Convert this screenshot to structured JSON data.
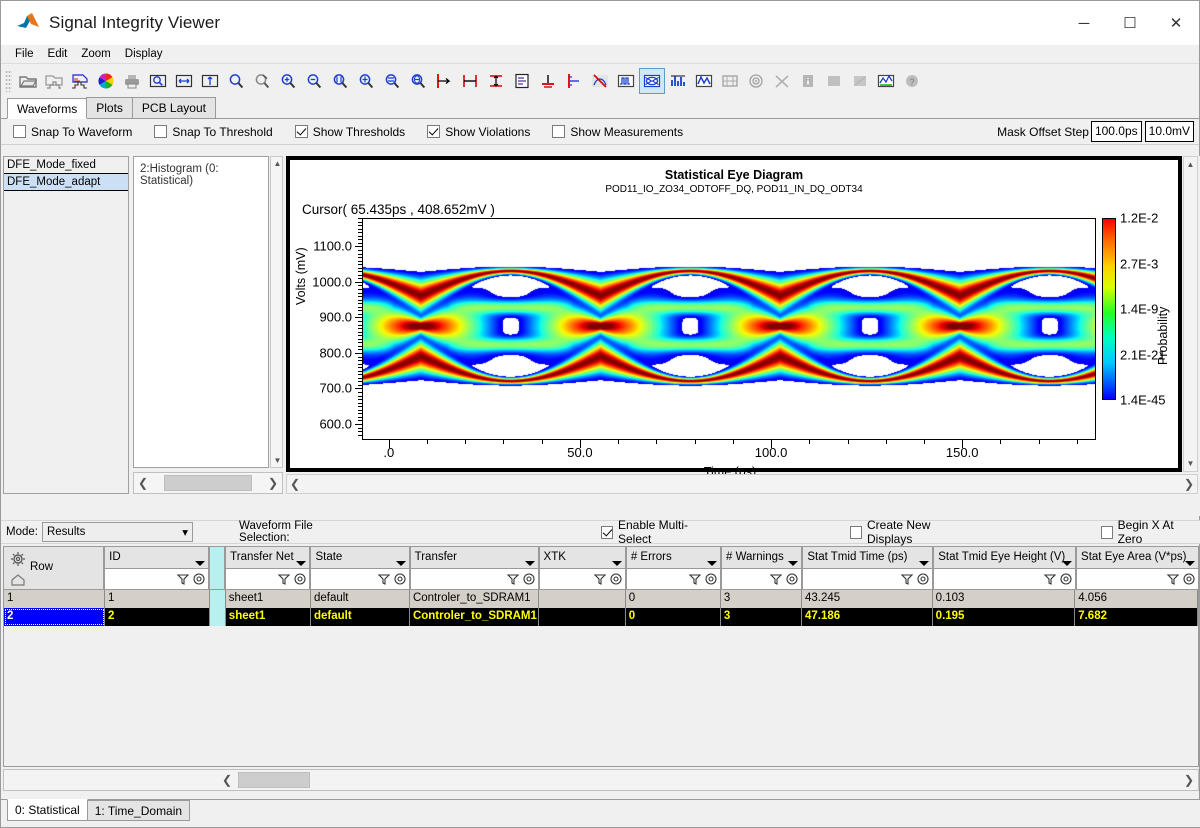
{
  "window": {
    "title": "Signal Integrity Viewer",
    "icon": "matlab-logo-icon",
    "minimize": "─",
    "maximize": "☐",
    "close": "✕"
  },
  "menu": {
    "items": [
      "File",
      "Edit",
      "Zoom",
      "Display"
    ]
  },
  "toolbar": {
    "icons": [
      "open-folder-icon",
      "open-waveform-icon",
      "save-waveform-icon",
      "color-wheel-icon",
      "print-icon",
      "zoom-region-icon",
      "pan-icon",
      "image-export-icon",
      "magnifier-icon",
      "magnifier-reset-icon",
      "zoom-in-icon",
      "zoom-out-icon",
      "zoom-x-in-icon",
      "zoom-x-out-icon",
      "zoom-y-in-icon",
      "zoom-y-out-icon",
      "cursor-left-icon",
      "measure-width-icon",
      "measure-height-icon",
      "notes-icon",
      "ground-ref-icon",
      "marker-icon",
      "no-crosstalk-icon",
      "waveform-view-icon",
      "eye-diagram-icon",
      "histogram-icon",
      "analog-wave-icon",
      "mask-icon",
      "bathtub-icon",
      "crossing-icon",
      "info-icon",
      "block1-icon",
      "block2-icon",
      "overlay-icon",
      "help-icon"
    ],
    "active_icon_index": 24
  },
  "tabs": {
    "items": [
      "Waveforms",
      "Plots",
      "PCB Layout"
    ],
    "selected": "Waveforms"
  },
  "options": {
    "checkboxes": [
      {
        "label": "Snap To Waveform",
        "checked": false
      },
      {
        "label": "Snap To Threshold",
        "checked": false
      },
      {
        "label": "Show Thresholds",
        "checked": true
      },
      {
        "label": "Show Violations",
        "checked": true
      },
      {
        "label": "Show Measurements",
        "checked": false
      }
    ],
    "mask_offset_label": "Mask Offset Step",
    "mask_offset_time": "100.0ps",
    "mask_offset_volt": "10.0mV"
  },
  "waveform_list": {
    "items": [
      {
        "label": "DFE_Mode_fixed",
        "selected": false
      },
      {
        "label": "DFE_Mode_adapt",
        "selected": true
      }
    ]
  },
  "histogram_panel": {
    "label": "2:Histogram   (0: Statistical)"
  },
  "chart_data": {
    "type": "heatmap",
    "title": "Statistical Eye Diagram",
    "subtitle": "POD11_IO_ZO34_ODTOFF_DQ, POD11_IN_DQ_ODT34",
    "cursor": "Cursor( 65.435ps , 408.652mV )",
    "xlabel": "Time (ps)",
    "ylabel": "Volts (mV)",
    "xticks": [
      ".0",
      "50.0",
      "100.0",
      "150.0"
    ],
    "xtick_values": [
      0,
      50,
      100,
      150
    ],
    "xlim": [
      -7,
      185
    ],
    "yticks": [
      "1100.0",
      "1000.0",
      "900.0",
      "800.0",
      "700.0",
      "600.0"
    ],
    "ytick_values": [
      1100,
      1000,
      900,
      800,
      700,
      600
    ],
    "ylim": [
      555,
      1180
    ],
    "grid": false,
    "colorbar": {
      "label": "Probability",
      "ticks": [
        "1.2E-2",
        "2.7E-3",
        "1.4E-9",
        "2.1E-21",
        "1.4E-45"
      ],
      "colors": [
        "#ff0000",
        "#ff9000",
        "#ffff00",
        "#00e000",
        "#00ffff",
        "#0000ff"
      ]
    }
  },
  "mode_bar": {
    "mode_label": "Mode:",
    "mode_value": "Results",
    "file_selection_label": "Waveform File Selection:",
    "checkboxes": [
      {
        "label": "Enable Multi-Select",
        "checked": true
      },
      {
        "label": "Create New Displays",
        "checked": false
      },
      {
        "label": "Begin X At Zero",
        "checked": false
      }
    ]
  },
  "table": {
    "row_header": "Row",
    "columns": [
      {
        "label": "ID",
        "width": 106
      },
      {
        "label": "",
        "width": 16
      },
      {
        "label": "Transfer Net",
        "width": 86
      },
      {
        "label": "State",
        "width": 100
      },
      {
        "label": "Transfer",
        "width": 130
      },
      {
        "label": "XTK",
        "width": 88
      },
      {
        "label": "# Errors",
        "width": 96
      },
      {
        "label": "# Warnings",
        "width": 82
      },
      {
        "label": "Stat Tmid Time (ps)",
        "width": 132
      },
      {
        "label": "Stat Tmid Eye Height (V)",
        "width": 144
      },
      {
        "label": "Stat Eye Area (V*ps)",
        "width": 124
      }
    ],
    "rows": [
      {
        "num": "1",
        "selected": false,
        "cells": [
          "1",
          "",
          "sheet1",
          "default",
          "Controler_to_SDRAM1",
          "",
          "0",
          "3",
          "43.245",
          "0.103",
          "4.056"
        ]
      },
      {
        "num": "2",
        "selected": true,
        "cells": [
          "2",
          "",
          "sheet1",
          "default",
          "Controler_to_SDRAM1",
          "",
          "0",
          "3",
          "47.186",
          "0.195",
          "7.682"
        ]
      }
    ]
  },
  "bottom_tabs": {
    "items": [
      "0: Statistical",
      "1: Time_Domain"
    ],
    "selected": "0: Statistical"
  }
}
